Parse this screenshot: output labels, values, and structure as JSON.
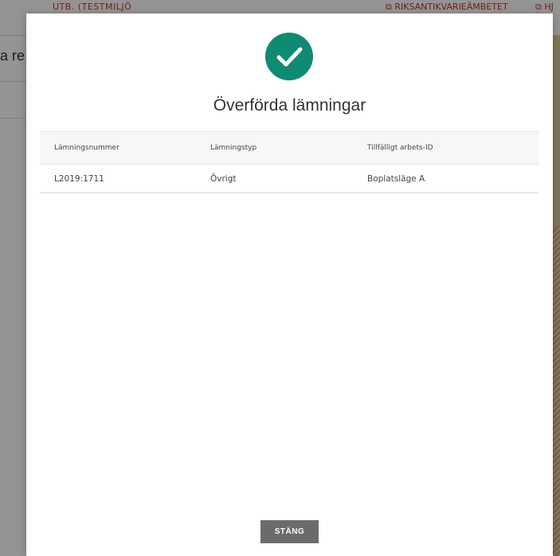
{
  "background": {
    "header_left": "UTB. (TESTMILJÖ",
    "header_link_1": "RIKSANTIKVARIEÄMBETET",
    "header_link_2": "HJ",
    "page_title_fragment": "a re"
  },
  "modal": {
    "icon": "check-icon",
    "icon_color": "#0f8a73",
    "title": "Överförda lämningar",
    "table": {
      "columns": [
        "Lämningsnummer",
        "Lämningstyp",
        "Tillfälligt arbets-ID"
      ],
      "rows": [
        [
          "L2019:1711",
          "Övrigt",
          "Boplatsläge A"
        ]
      ]
    },
    "close_label": "STÄNG",
    "close_color": "#6b6b6b"
  }
}
